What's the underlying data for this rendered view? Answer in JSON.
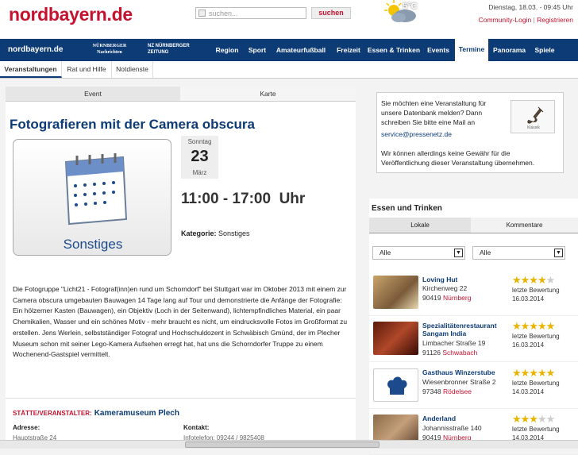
{
  "header": {
    "logo": "nordbayern.de",
    "search_placeholder": "suchen...",
    "search_button": "suchen",
    "temperature": "5°C",
    "datetime": "Dienstag, 18.03. - 09:45 Uhr",
    "login": "Community-Login",
    "register": "Registrieren"
  },
  "nav": {
    "brand": "nordbayern.de",
    "brand2": "NÜRNBERGER Nachrichten",
    "brand3": "NZ NÜRNBERGER ZEITUNG",
    "items": [
      "Region",
      "Sport",
      "Amateurfußball",
      "Freizeit",
      "Essen & Trinken",
      "Events",
      "Termine",
      "Panorama",
      "Spiele"
    ],
    "active": "Termine"
  },
  "subnav": [
    "Veranstaltungen",
    "Rat und Hilfe",
    "Notdienste"
  ],
  "event": {
    "tabs": [
      "Event",
      "Karte"
    ],
    "title": "Fotografieren mit der Camera obscura",
    "thumb_label": "Sonstiges",
    "weekday": "Sonntag",
    "day": "23",
    "month": "März",
    "time": "11:00 - 17:00  Uhr",
    "category_label": "Kategorie:",
    "category": "Sonstiges",
    "description": "Die Fotogruppe \"Licht21 - Fotograf(inn)en rund um Schorndorf\" bei Stuttgart war im Oktober 2013 mit einem zur Camera obscura umgebauten Bauwagen 14 Tage lang auf Tour und demonstrierte die Anfänge der Fotografie: Ein hölzerner Kasten (Bauwagen), ein Objektiv (Loch in der Seitenwand), lichtempfindliches Material, ein paar Chemikalien, Wasser und ein schönes Motiv - mehr braucht es nicht, um eindrucksvolle Fotos im Großformat zu erstellen. Jens Werlein, selbstständiger Fotograf und Hochschuldozent in Schwäbisch Gmünd, der im Plecher Museum schon mit seiner Lego-Kamera Aufsehen erregt hat, hat uns die Schorndorfer Truppe zu einem Wochenend-Gastspiel vermittelt.",
    "venue_label": "STÄTTE/VERANSTALTER:",
    "venue": "Kameramuseum Plech",
    "address_label": "Adresse:",
    "contact_label": "Kontakt:",
    "address": "Hauptstraße 24",
    "contact": "Infotelefon: 09244 / 9825408"
  },
  "infobox": {
    "text": "Sie möchten eine Veranstaltung für unsere Datenbank melden? Dann schreiben Sie bitte eine Mail an",
    "email": "service@pressenetz.de",
    "note": "Wir können allerdings keine Gewähr für die Veröffentlichung dieser Veranstaltung übernehmen.",
    "image_label": "Klassik"
  },
  "essen": {
    "title": "Essen und Trinken",
    "tabs": [
      "Lokale",
      "Kommentare"
    ],
    "filter1": "Alle",
    "filter2": "Alle",
    "restaurants": [
      {
        "name": "Loving Hut",
        "street": "Kirchenweg 22",
        "zip": "90419",
        "city": "Nürnberg",
        "stars": 4,
        "last_label": "letzte Bewertung",
        "last_date": "16.03.2014"
      },
      {
        "name": "Spezialitätenrestaurant Sangam India",
        "street": "Limbacher Straße 19",
        "zip": "91126",
        "city": "Schwabach",
        "stars": 5,
        "last_label": "letzte Bewertung",
        "last_date": "16.03.2014"
      },
      {
        "name": "Gasthaus Winzerstube",
        "street": "Wiesenbronner Straße 2",
        "zip": "97348",
        "city": "Rödelsee",
        "stars": 5,
        "last_label": "letzte Bewertung",
        "last_date": "14.03.2014"
      },
      {
        "name": "Anderland",
        "street": "Johannisstraße 140",
        "zip": "90419",
        "city": "Nürnberg",
        "stars": 3,
        "last_label": "letzte Bewertung",
        "last_date": "14.03.2014"
      }
    ]
  },
  "colors": {
    "brand_red": "#c4122f",
    "nav_blue": "#0d3b76",
    "star": "#e8b400"
  }
}
